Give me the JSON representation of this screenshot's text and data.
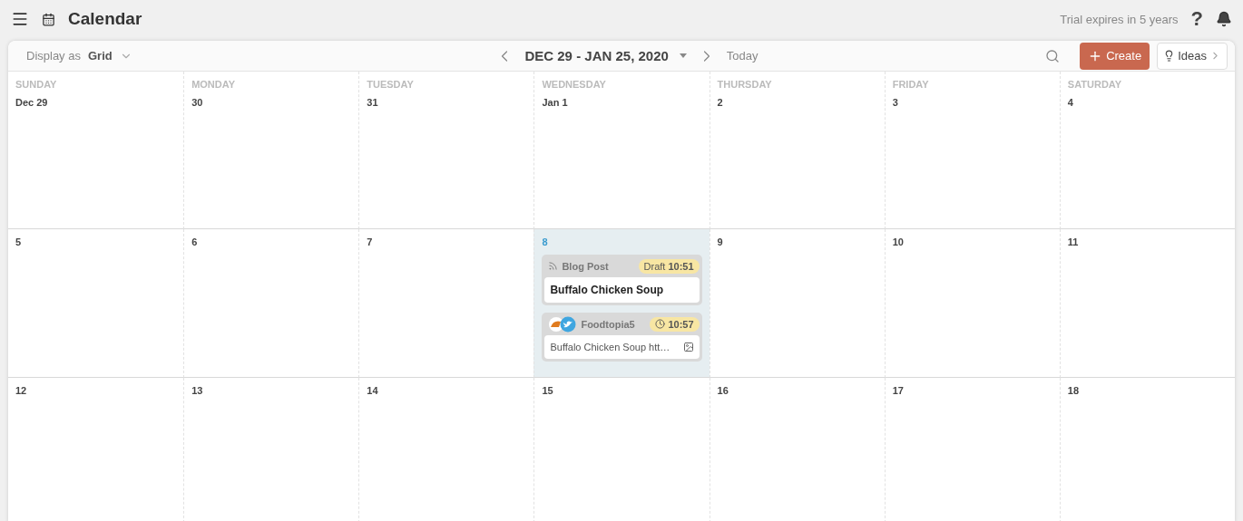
{
  "header": {
    "title": "Calendar",
    "trial": "Trial expires in 5 years",
    "help": "?"
  },
  "toolbar": {
    "display_label": "Display as",
    "display_value": "Grid",
    "range": "DEC 29 - JAN 25, 2020",
    "today": "Today",
    "create": "Create",
    "ideas": "Ideas"
  },
  "weekdays": [
    "SUNDAY",
    "MONDAY",
    "TUESDAY",
    "WEDNESDAY",
    "THURSDAY",
    "FRIDAY",
    "SATURDAY"
  ],
  "weeks": [
    {
      "days": [
        {
          "date": "Dec 29",
          "today": false
        },
        {
          "date": "30",
          "today": false
        },
        {
          "date": "31",
          "today": false
        },
        {
          "date": "Jan 1",
          "today": false
        },
        {
          "date": "2",
          "today": false
        },
        {
          "date": "3",
          "today": false
        },
        {
          "date": "4",
          "today": false
        }
      ]
    },
    {
      "days": [
        {
          "date": "5",
          "today": false
        },
        {
          "date": "6",
          "today": false
        },
        {
          "date": "7",
          "today": false
        },
        {
          "date": "8",
          "today": true,
          "posts": [
            {
              "kind": "blog",
              "source": "Blog Post",
              "status": "Draft",
              "time": "10:51",
              "title": "Buffalo Chicken Soup"
            },
            {
              "kind": "social",
              "source": "Foodtopia5",
              "time": "10:57",
              "text": "Buffalo Chicken Soup htt…"
            }
          ]
        },
        {
          "date": "9",
          "today": false
        },
        {
          "date": "10",
          "today": false
        },
        {
          "date": "11",
          "today": false
        }
      ]
    },
    {
      "days": [
        {
          "date": "12",
          "today": false
        },
        {
          "date": "13",
          "today": false
        },
        {
          "date": "14",
          "today": false
        },
        {
          "date": "15",
          "today": false
        },
        {
          "date": "16",
          "today": false
        },
        {
          "date": "17",
          "today": false
        },
        {
          "date": "18",
          "today": false
        }
      ]
    }
  ]
}
